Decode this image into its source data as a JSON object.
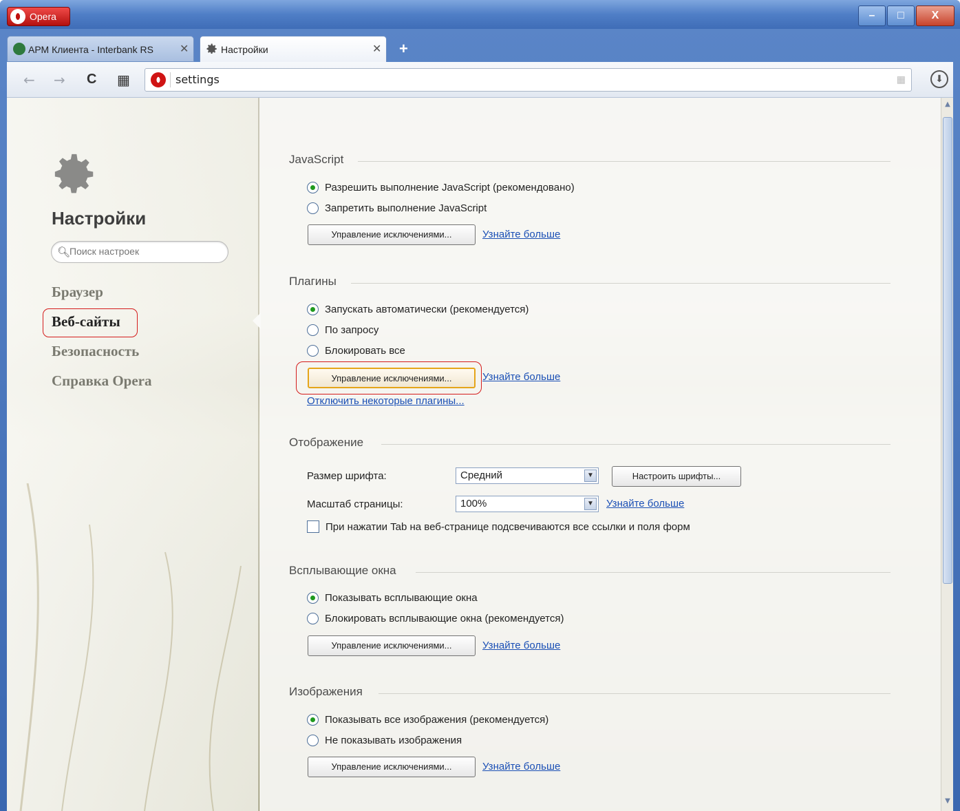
{
  "window": {
    "menu_label": "Opera",
    "controls": {
      "minimize": "–",
      "maximize": "□",
      "close": "X"
    }
  },
  "tabs": [
    {
      "label": "АРМ Клиента - Interbank RS",
      "close": "✕",
      "favicon": "interbank-icon"
    },
    {
      "label": "Настройки",
      "close": "✕",
      "favicon": "gear-icon"
    }
  ],
  "new_tab": "+",
  "toolbar": {
    "back": "←",
    "forward": "→",
    "reload": "C",
    "speed_dial": "▦",
    "url": "settings",
    "download": "⬇"
  },
  "sidebar": {
    "title": "Настройки",
    "search_placeholder": "Поиск настроек",
    "items": [
      {
        "label": "Браузер"
      },
      {
        "label": "Веб-сайты"
      },
      {
        "label": "Безопасность"
      },
      {
        "label": "Справка Opera"
      }
    ]
  },
  "sections": {
    "javascript": {
      "title": "JavaScript",
      "options": [
        "Разрешить выполнение JavaScript (рекомендовано)",
        "Запретить выполнение JavaScript"
      ],
      "button": "Управление исключениями...",
      "link": "Узнайте больше"
    },
    "plugins": {
      "title": "Плагины",
      "options": [
        "Запускать автоматически (рекомендуется)",
        "По запросу",
        "Блокировать все"
      ],
      "button": "Управление исключениями...",
      "link": "Узнайте больше",
      "disable_link": "Отключить некоторые плагины..."
    },
    "display": {
      "title": "Отображение",
      "font_size_label": "Размер шрифта:",
      "font_size_value": "Средний",
      "fonts_button": "Настроить шрифты...",
      "zoom_label": "Масштаб страницы:",
      "zoom_value": "100%",
      "link": "Узнайте больше",
      "tab_checkbox": "При нажатии Tab на веб-странице подсвечиваются все ссылки и поля форм"
    },
    "popups": {
      "title": "Всплывающие окна",
      "options": [
        "Показывать всплывающие окна",
        "Блокировать всплывающие окна (рекомендуется)"
      ],
      "button": "Управление исключениями...",
      "link": "Узнайте больше"
    },
    "images": {
      "title": "Изображения",
      "options": [
        "Показывать все изображения (рекомендуется)",
        "Не показывать изображения"
      ],
      "button": "Управление исключениями...",
      "link": "Узнайте больше"
    }
  },
  "colors": {
    "accent_link": "#1a4fb5",
    "highlight_ring": "#d41b1b",
    "radio_checked": "#1f9a1f"
  }
}
